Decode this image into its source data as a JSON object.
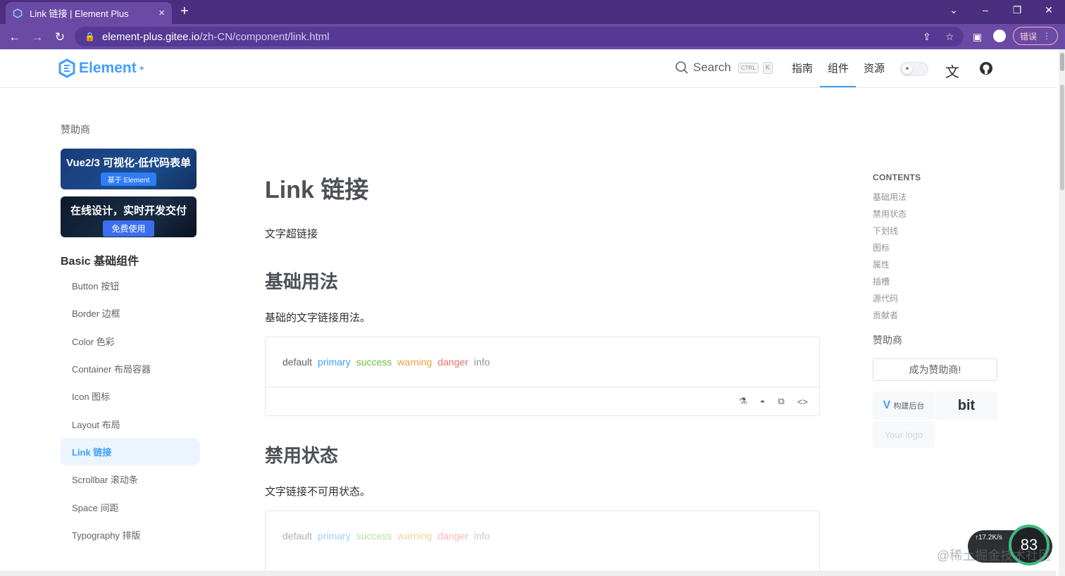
{
  "browser": {
    "tab_title": "Link 链接 | Element Plus",
    "tab_close": "×",
    "new_tab": "+",
    "url_host": "element-plus.gitee.io",
    "url_path": "/zh-CN/component/link.html",
    "error_label": "错误",
    "menu_dots": "⋮"
  },
  "header": {
    "logo_text": "Element",
    "logo_plus": "+",
    "search_label": "Search",
    "kbd_ctrl": "CTRL",
    "kbd_k": "K",
    "nav": [
      "指南",
      "组件",
      "资源"
    ],
    "active_nav_index": 1,
    "accent_color": "#409eff"
  },
  "sidebar": {
    "sponsor_label": "赞助商",
    "banners": [
      {
        "main": "Vue2/3 可视化-低代码表单",
        "sub": "基于 Element"
      },
      {
        "main": "在线设计，实时开发交付",
        "sub": "免费使用"
      }
    ],
    "group_title": "Basic 基础组件",
    "items": [
      {
        "label": "Button 按钮"
      },
      {
        "label": "Border 边框"
      },
      {
        "label": "Color 色彩"
      },
      {
        "label": "Container 布局容器"
      },
      {
        "label": "Icon 图标"
      },
      {
        "label": "Layout 布局"
      },
      {
        "label": "Link 链接"
      },
      {
        "label": "Scrollbar 滚动条"
      },
      {
        "label": "Space 间距"
      },
      {
        "label": "Typography 排版"
      }
    ],
    "active_index": 6
  },
  "main": {
    "title": "Link 链接",
    "lead": "文字超链接",
    "sections": [
      {
        "heading": "基础用法",
        "desc": "基础的文字链接用法。"
      },
      {
        "heading": "禁用状态",
        "desc": "文字链接不可用状态。"
      }
    ],
    "links": [
      "default",
      "primary",
      "success",
      "warning",
      "danger",
      "info"
    ]
  },
  "toc": {
    "title": "CONTENTS",
    "items": [
      "基础用法",
      "禁用状态",
      "下划线",
      "图标",
      "属性",
      "插槽",
      "源代码",
      "贡献者"
    ],
    "sponsor_label": "赞助商",
    "become_sponsor": "成为赞助商!",
    "sponsor1": "构建后台",
    "sponsor2": "bit",
    "sponsor3": "Your logo"
  },
  "overlay": {
    "net_speed": "↑17.2K/s",
    "percent": "83",
    "watermark": "@稀土掘金技术社区"
  }
}
